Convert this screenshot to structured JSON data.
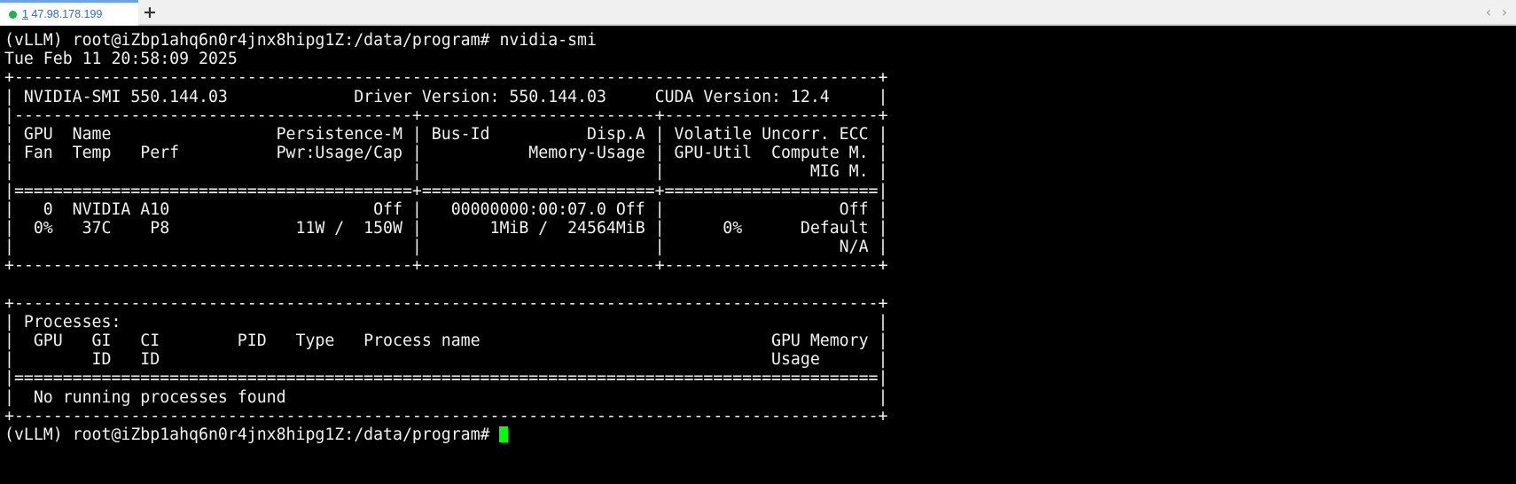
{
  "tabbar": {
    "tab_index": "1",
    "tab_host": " 47.98.178.199",
    "new_tab_symbol": "+",
    "nav_prev_symbol": "‹",
    "nav_next_symbol": "›"
  },
  "colors": {
    "background": "#000000",
    "text": "#f2f2f2",
    "cursor": "#00ff00",
    "tab_accent": "#6aa3e8",
    "status_dot": "#22b14c"
  },
  "terminal": {
    "lines": [
      "(vLLM) root@iZbp1ahq6n0r4jnx8hipg1Z:/data/program# nvidia-smi",
      "Tue Feb 11 20:58:09 2025",
      "+-----------------------------------------------------------------------------------------+",
      "| NVIDIA-SMI 550.144.03             Driver Version: 550.144.03     CUDA Version: 12.4     |",
      "|-----------------------------------------+------------------------+----------------------+",
      "| GPU  Name                 Persistence-M | Bus-Id          Disp.A | Volatile Uncorr. ECC |",
      "| Fan  Temp   Perf          Pwr:Usage/Cap |           Memory-Usage | GPU-Util  Compute M. |",
      "|                                         |                        |               MIG M. |",
      "|=========================================+========================+======================|",
      "|   0  NVIDIA A10                     Off |   00000000:00:07.0 Off |                  Off |",
      "|  0%   37C    P8             11W /  150W |       1MiB /  24564MiB |      0%      Default |",
      "|                                         |                        |                  N/A |",
      "+-----------------------------------------+------------------------+----------------------+",
      "",
      "+-----------------------------------------------------------------------------------------+",
      "| Processes:                                                                              |",
      "|  GPU   GI   CI        PID   Type   Process name                              GPU Memory |",
      "|        ID   ID                                                               Usage      |",
      "|=========================================================================================|",
      "|  No running processes found                                                             |",
      "+-----------------------------------------------------------------------------------------+"
    ],
    "prompt": "(vLLM) root@iZbp1ahq6n0r4jnx8hipg1Z:/data/program# "
  }
}
